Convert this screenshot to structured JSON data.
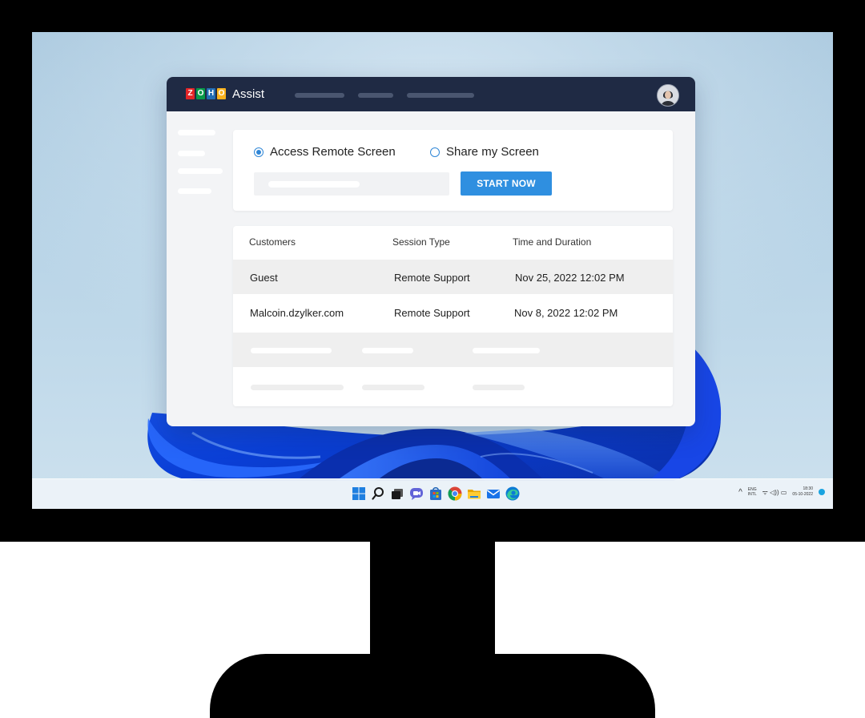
{
  "app": {
    "logo_letters": [
      {
        "char": "Z",
        "color": "#e42527"
      },
      {
        "char": "O",
        "color": "#089949"
      },
      {
        "char": "H",
        "color": "#226db4"
      },
      {
        "char": "O",
        "color": "#f9b21d"
      }
    ],
    "name": "Assist"
  },
  "connect_card": {
    "options": [
      {
        "label": "Access Remote Screen",
        "selected": true
      },
      {
        "label": "Share my Screen",
        "selected": false
      }
    ],
    "start_button_label": "START NOW"
  },
  "sessions_table": {
    "columns": [
      "Customers",
      "Session Type",
      "Time and Duration"
    ],
    "rows": [
      {
        "customer": "Guest",
        "session_type": "Remote Support",
        "time": "Nov 25, 2022 12:02 PM"
      },
      {
        "customer": "Malcoin.dzylker.com",
        "session_type": "Remote Support",
        "time": "Nov 8, 2022 12:02 PM"
      }
    ]
  },
  "taskbar": {
    "icons": [
      "windows-start-icon",
      "search-icon",
      "task-view-icon",
      "teams-chat-icon",
      "microsoft-store-icon",
      "chrome-icon",
      "file-explorer-icon",
      "mail-icon",
      "edge-icon"
    ],
    "tray": {
      "chevron": "^",
      "lang_line1": "ENG",
      "lang_line2": "INTL",
      "status_symbols": "ᯤ ◁)) ▭",
      "time": "18:30",
      "date": "05-10-2022"
    }
  },
  "colors": {
    "header_bg": "#1f2a44",
    "accent": "#2f8fe0",
    "selected_row": "#efefef"
  }
}
